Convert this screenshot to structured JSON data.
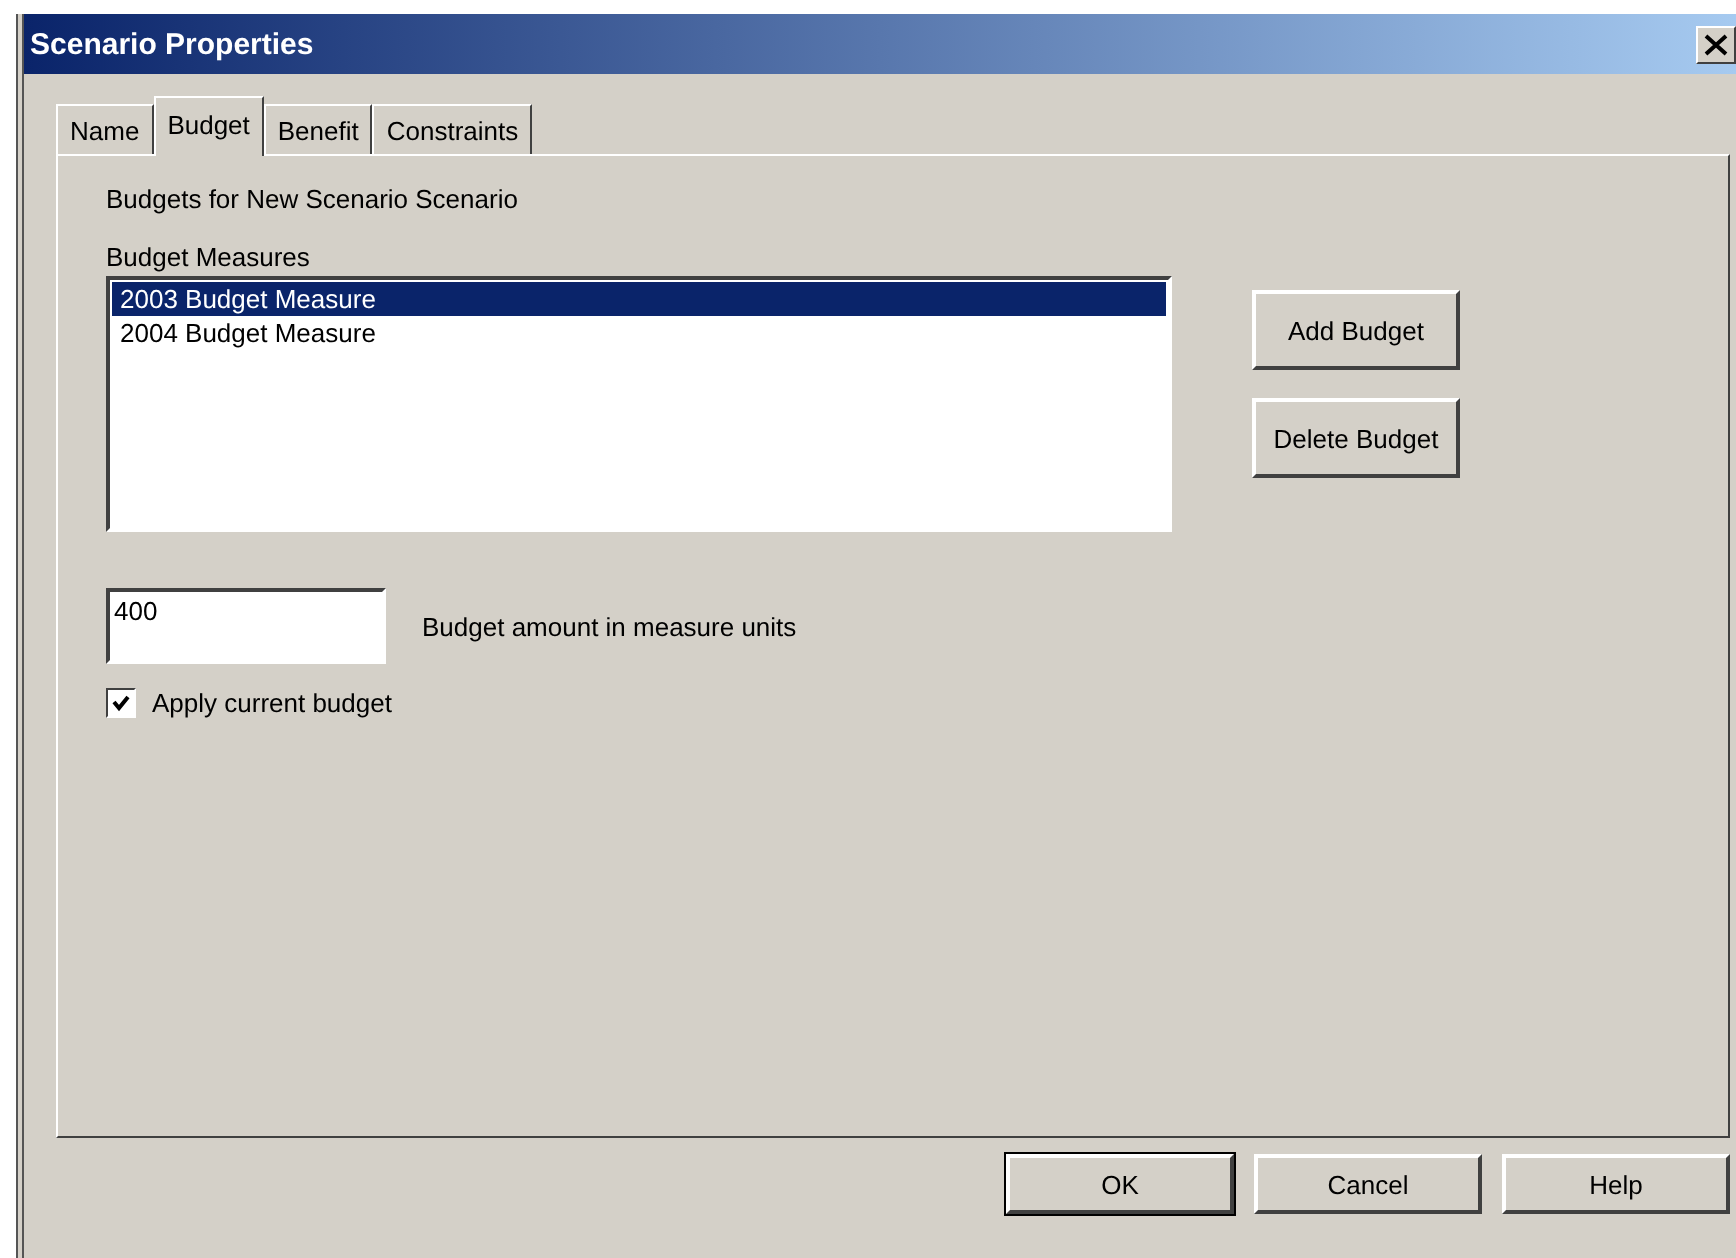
{
  "window": {
    "title": "Scenario Properties"
  },
  "tabs": [
    {
      "label": "Name",
      "selected": false
    },
    {
      "label": "Budget",
      "selected": true
    },
    {
      "label": "Benefit",
      "selected": false
    },
    {
      "label": "Constraints",
      "selected": false
    }
  ],
  "heading": "Budgets for New Scenario Scenario",
  "budget_measures": {
    "label": "Budget Measures",
    "items": [
      {
        "label": "2003 Budget Measure",
        "selected": true
      },
      {
        "label": "2004 Budget Measure",
        "selected": false
      }
    ]
  },
  "side_buttons": [
    "Add Budget",
    "Delete Budget"
  ],
  "amount": {
    "value": "400",
    "label": "Budget amount in measure units"
  },
  "apply": {
    "label": "Apply current budget",
    "checked": true
  },
  "buttons": [
    {
      "label": "OK",
      "default": true
    },
    {
      "label": "Cancel",
      "default": false
    },
    {
      "label": "Help",
      "default": false
    }
  ]
}
